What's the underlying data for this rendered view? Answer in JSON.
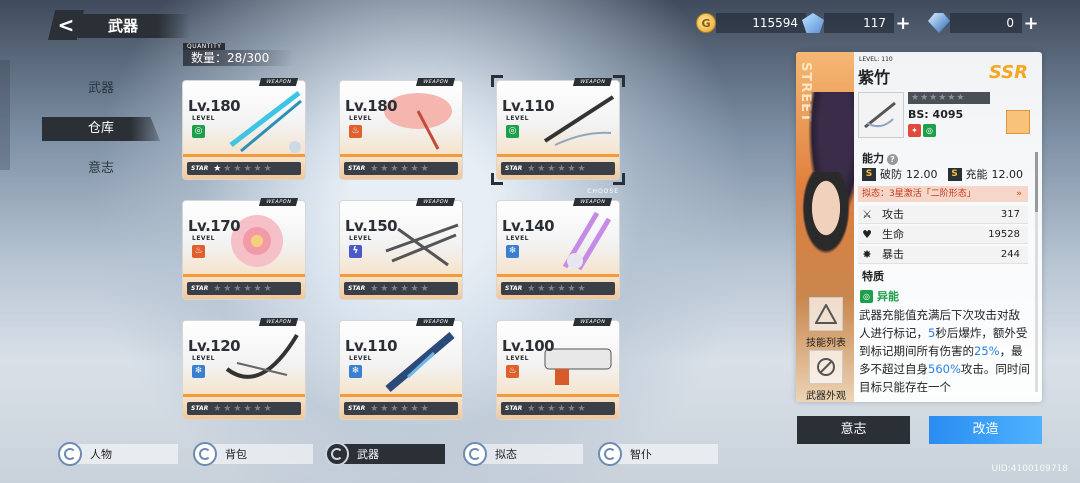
{
  "header": {
    "back_icon": "chevron-left-icon",
    "title": "武器"
  },
  "currencies": [
    {
      "icon": "gold-coin-icon",
      "value": "115594"
    },
    {
      "icon": "blue-gem-icon",
      "value": "117",
      "plus": "+"
    },
    {
      "icon": "crystal-icon",
      "value": "0",
      "plus": "+"
    }
  ],
  "side_nav": [
    {
      "label": "武器",
      "active": false
    },
    {
      "label": "仓库",
      "active": true
    },
    {
      "label": "意志",
      "active": false
    }
  ],
  "quantity": {
    "label": "QUANTITY",
    "value": "数量：28/300"
  },
  "cards": [
    {
      "level": "Lv.180",
      "element": "green",
      "stars": 1,
      "selected": false
    },
    {
      "level": "Lv.180",
      "element": "fire",
      "stars": 0,
      "selected": false
    },
    {
      "level": "Lv.110",
      "element": "green",
      "stars": 0,
      "selected": true
    },
    {
      "level": "Lv.170",
      "element": "fire",
      "stars": 0,
      "selected": false
    },
    {
      "level": "Lv.150",
      "element": "volt",
      "stars": 0,
      "selected": false
    },
    {
      "level": "Lv.140",
      "element": "ice",
      "stars": 0,
      "selected": false
    },
    {
      "level": "Lv.120",
      "element": "ice",
      "stars": 0,
      "selected": false
    },
    {
      "level": "Lv.110",
      "element": "ice",
      "stars": 0,
      "selected": false
    },
    {
      "level": "Lv.100",
      "element": "fire",
      "stars": 0,
      "selected": false
    }
  ],
  "card_text": {
    "tag": "WEAPON",
    "level_word": "LEVEL",
    "star_word": "STAR",
    "choose": "CHOOSE"
  },
  "detail": {
    "portrait_text": "STREET",
    "level": "LEVEL: 110",
    "name": "紫竹",
    "rarity": "SSR",
    "bs": "BS: 4095",
    "ability_title": "能力",
    "ability_1_name": "破防",
    "ability_1_val": "12.00",
    "ability_2_name": "充能",
    "ability_2_val": "12.00",
    "s_badge": "S",
    "mimic": "拟态：3星激活「二阶形态」",
    "mimic_arrow": "»",
    "stats": [
      {
        "icon": "sword-icon",
        "name": "攻击",
        "value": "317"
      },
      {
        "icon": "heart-icon",
        "name": "生命",
        "value": "19528"
      },
      {
        "icon": "burst-icon",
        "name": "暴击",
        "value": "244"
      }
    ],
    "trait_title": "特质",
    "trait_name": "异能",
    "desc_1": "武器充能值充满后下次攻击对敌人进行标记，",
    "desc_hl_1": "5",
    "desc_2": "秒后爆炸，额外受到标记期间所有伤害的",
    "desc_hl_2": "25%",
    "desc_3": "，最多不超过自身",
    "desc_hl_3": "560%",
    "desc_4": "攻击。同时间目标只能存在一个",
    "side_action_1": "技能列表",
    "side_action_2": "武器外观"
  },
  "buttons": {
    "will": "意志",
    "upgrade": "改造"
  },
  "bottom_tabs": [
    {
      "label": "人物",
      "active": false
    },
    {
      "label": "背包",
      "active": false
    },
    {
      "label": "武器",
      "active": true
    },
    {
      "label": "拟态",
      "active": false
    },
    {
      "label": "智仆",
      "active": false
    }
  ],
  "uid": "UID:4100109718"
}
